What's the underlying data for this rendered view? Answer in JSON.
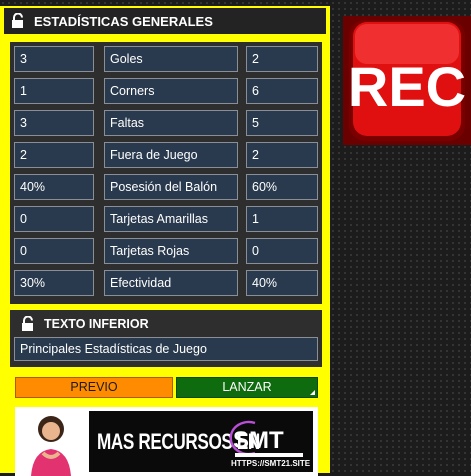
{
  "header": {
    "title": "ESTADÍSTICAS GENERALES",
    "lock_icon": "unlock-icon"
  },
  "stats": [
    {
      "left": "3",
      "label": "Goles",
      "right": "2"
    },
    {
      "left": "1",
      "label": "Corners",
      "right": "6"
    },
    {
      "left": "3",
      "label": "Faltas",
      "right": "5"
    },
    {
      "left": "2",
      "label": "Fuera de Juego",
      "right": "2"
    },
    {
      "left": "40%",
      "label": "Posesión del Balón",
      "right": "60%"
    },
    {
      "left": "0",
      "label": "Tarjetas Amarillas",
      "right": "1"
    },
    {
      "left": "0",
      "label": "Tarjetas Rojas",
      "right": "0"
    },
    {
      "left": "30%",
      "label": "Efectividad",
      "right": "40%"
    }
  ],
  "lower": {
    "title": "TEXTO INFERIOR",
    "value": "Principales Estadísticas de Juego"
  },
  "buttons": {
    "previo": "PREVIO",
    "lanzar": "LANZAR"
  },
  "banner": {
    "text": "MAS RECURSOS EN",
    "logo": "SMT",
    "url": "HTTPS://SMT21.SITE"
  },
  "rec": {
    "label": "REC"
  },
  "colors": {
    "panel": "#ffff00",
    "header": "#232323",
    "field": "#2a3a4e",
    "previo": "#ff8c00",
    "lanzar": "#0e6b0e",
    "rec": "#e01010"
  }
}
